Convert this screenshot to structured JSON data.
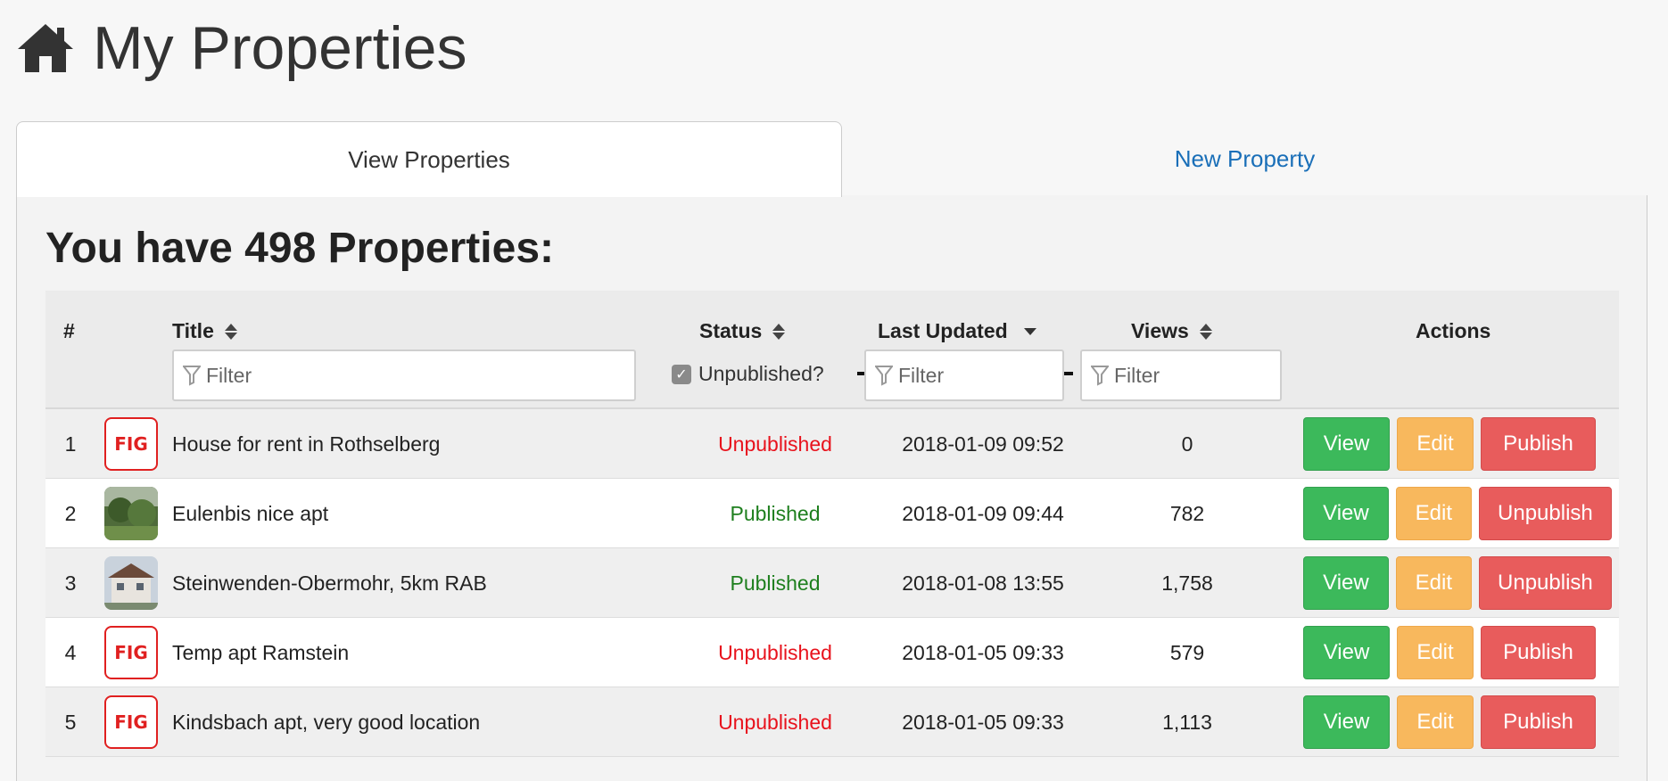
{
  "header": {
    "title": "My Properties",
    "icon": "home-icon"
  },
  "tabs": {
    "view": "View Properties",
    "new": "New Property"
  },
  "panel": {
    "title": "You have 498 Properties:"
  },
  "table": {
    "columns": {
      "num": "#",
      "title": "Title",
      "status": "Status",
      "updated": "Last Updated",
      "views": "Views",
      "actions": "Actions"
    },
    "filters": {
      "title_placeholder": "Filter",
      "updated_placeholder": "Filter",
      "views_placeholder": "Filter",
      "unpublished_label": "Unpublished?"
    },
    "rows": [
      {
        "num": "1",
        "thumb": "logo",
        "title": "House for rent in Rothselberg",
        "status": "Unpublished",
        "updated": "2018-01-09 09:52",
        "views": "0",
        "action": "Publish"
      },
      {
        "num": "2",
        "thumb": "photo",
        "title": "Eulenbis nice apt",
        "status": "Published",
        "updated": "2018-01-09 09:44",
        "views": "782",
        "action": "Unpublish"
      },
      {
        "num": "3",
        "thumb": "photo",
        "title": "Steinwenden-Obermohr, 5km RAB",
        "status": "Published",
        "updated": "2018-01-08 13:55",
        "views": "1,758",
        "action": "Unpublish"
      },
      {
        "num": "4",
        "thumb": "logo",
        "title": "Temp apt Ramstein",
        "status": "Unpublished",
        "updated": "2018-01-05 09:33",
        "views": "579",
        "action": "Publish"
      },
      {
        "num": "5",
        "thumb": "logo",
        "title": "Kindsbach apt, very good location",
        "status": "Unpublished",
        "updated": "2018-01-05 09:33",
        "views": "1,113",
        "action": "Publish"
      }
    ],
    "buttons": {
      "view": "View",
      "edit": "Edit"
    },
    "logo_text": "FIG"
  },
  "colors": {
    "link": "#1a6fb8",
    "unpublished": "#e8121c",
    "published": "#1e7f1e",
    "view_btn": "#3cb95b",
    "edit_btn": "#f8b85d",
    "publish_btn": "#e85c5c"
  }
}
